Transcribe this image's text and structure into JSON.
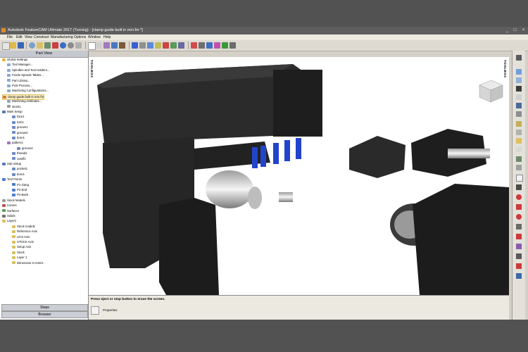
{
  "window": {
    "title": "Autodesk FeatureCAM Ultimate 2017 (Turning) - [clamp guide built in mm.fm *]",
    "controls": [
      "_",
      "□",
      "×"
    ]
  },
  "menubar": [
    "File",
    "Edit",
    "View",
    "Construct",
    "Manufacturing",
    "Options",
    "Window",
    "Help"
  ],
  "left_panel": {
    "header": "Part View",
    "tree": [
      {
        "label": "Global Settings",
        "indent": 0,
        "icon": "folder-icon"
      },
      {
        "label": "Tool Manager...",
        "indent": 1,
        "icon": "tool-icon"
      },
      {
        "label": "Spindles and Tool Holders...",
        "indent": 1,
        "icon": "tool-icon"
      },
      {
        "label": "Feeds  Speeds Tables...",
        "indent": 1,
        "icon": "tool-icon"
      },
      {
        "label": "Part Library...",
        "indent": 1,
        "icon": "tool-icon"
      },
      {
        "label": "Post Process...",
        "indent": 1,
        "icon": "tool-icon"
      },
      {
        "label": "Machining Configurations...",
        "indent": 1,
        "icon": "tool-icon"
      },
      {
        "label": "clamp guide built in mm.fm",
        "indent": 0,
        "icon": "part-icon",
        "selected": true
      },
      {
        "label": "Machining Attributes...",
        "indent": 1,
        "icon": "tool-icon"
      },
      {
        "label": "stock1",
        "indent": 1,
        "icon": "stock-icon"
      },
      {
        "label": "Main Setup",
        "indent": 0,
        "icon": "setup-icon"
      },
      {
        "label": "face1",
        "indent": 2,
        "icon": "feature-icon"
      },
      {
        "label": "turn1",
        "indent": 2,
        "icon": "feature-icon"
      },
      {
        "label": "groove1",
        "indent": 2,
        "icon": "feature-icon"
      },
      {
        "label": "groove2",
        "indent": 2,
        "icon": "feature-icon"
      },
      {
        "label": "bore1",
        "indent": 2,
        "icon": "feature-icon"
      },
      {
        "label": "pattern1",
        "indent": 1,
        "icon": "pattern-icon"
      },
      {
        "label": "groove3",
        "indent": 3,
        "icon": "feature-icon"
      },
      {
        "label": "thread1",
        "indent": 2,
        "icon": "feature-icon"
      },
      {
        "label": "cutoff1",
        "indent": 2,
        "icon": "feature-icon"
      },
      {
        "label": "Sub Setup",
        "indent": 0,
        "icon": "setup-icon"
      },
      {
        "label": "pocket1",
        "indent": 2,
        "icon": "feature-icon"
      },
      {
        "label": "bore1",
        "indent": 2,
        "icon": "feature-icon"
      },
      {
        "label": "Tool Points",
        "indent": 0,
        "icon": "point-icon"
      },
      {
        "label": "P1 Gang",
        "indent": 2,
        "icon": "point-icon"
      },
      {
        "label": "P2 End",
        "indent": 2,
        "icon": "point-icon"
      },
      {
        "label": "P4 Back",
        "indent": 2,
        "icon": "point-icon"
      },
      {
        "label": "Stock Models",
        "indent": 0,
        "icon": "stock-icon"
      },
      {
        "label": "Curves",
        "indent": 0,
        "icon": "curve-icon"
      },
      {
        "label": "Surfaces",
        "indent": 0,
        "icon": "surface-icon"
      },
      {
        "label": "Solids",
        "indent": 0,
        "icon": "solid-icon"
      },
      {
        "label": "Layers",
        "indent": 0,
        "icon": "layer-icon"
      },
      {
        "label": "Stock models",
        "indent": 2,
        "icon": "layer-icon"
      },
      {
        "label": "Reference Axis",
        "indent": 2,
        "icon": "layer-icon"
      },
      {
        "label": "UCS Axis",
        "indent": 2,
        "icon": "layer-icon"
      },
      {
        "label": "STOCK Axis",
        "indent": 2,
        "icon": "layer-icon"
      },
      {
        "label": "Setup Axis",
        "indent": 2,
        "icon": "layer-icon"
      },
      {
        "label": "Stock",
        "indent": 2,
        "icon": "layer-icon"
      },
      {
        "label": "Layer 1",
        "indent": 2,
        "icon": "layer-icon"
      },
      {
        "label": "Dimension in metric",
        "indent": 2,
        "icon": "layer-icon"
      }
    ],
    "bottom_tabs": [
      "Steps",
      "Browser"
    ]
  },
  "viewport": {
    "left_vertical_label": "TOOLBOX",
    "right_vertical_label": "TOOLBOX"
  },
  "status": {
    "message": "Press eject or stop button to erase the screen.",
    "properties_label": "Properties"
  },
  "colors": {
    "accent_blue": "#2244cc",
    "selection": "#fbeec7",
    "part_dark": "#262626"
  }
}
